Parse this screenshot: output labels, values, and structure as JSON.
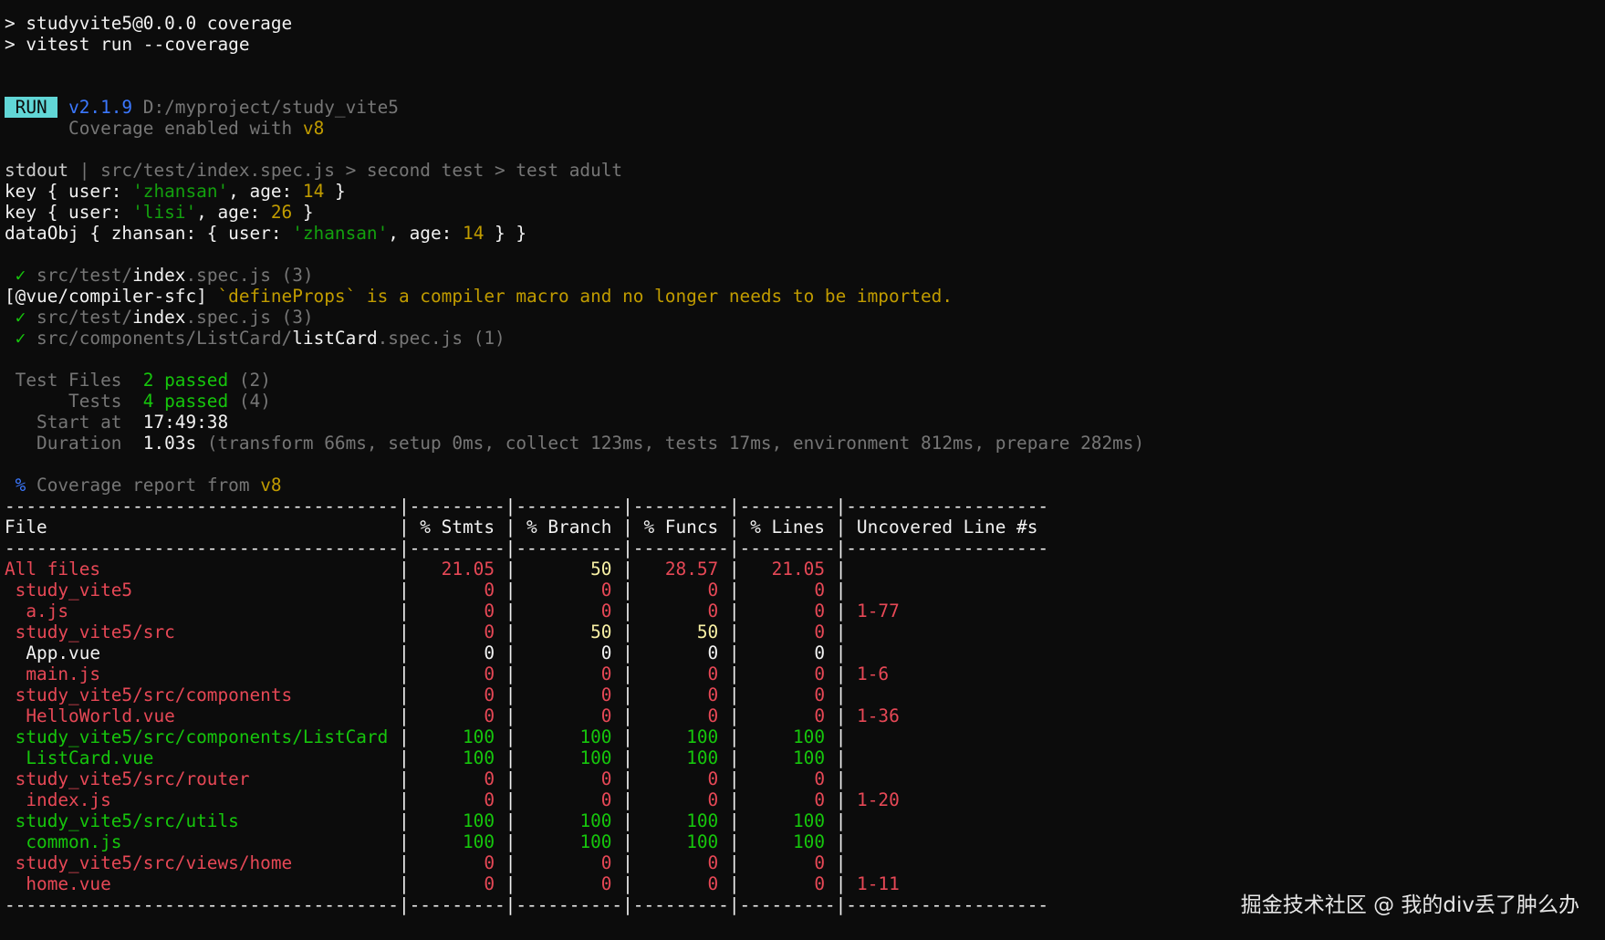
{
  "watermark": "掘金技术社区 @ 我的div丢了肿么办",
  "lines": [
    [
      {
        "t": "> studyvite5@0.0.0 coverage",
        "c": "white"
      }
    ],
    [
      {
        "t": "> vitest run --coverage",
        "c": "white"
      }
    ],
    [],
    [],
    [
      {
        "t": " RUN ",
        "c": "badge"
      },
      {
        "t": " ",
        "c": "default"
      },
      {
        "t": "v2.1.9",
        "c": "blue"
      },
      {
        "t": " D:/myproject/study_vite5",
        "c": "dim"
      }
    ],
    [
      {
        "t": "      Coverage enabled with ",
        "c": "dim"
      },
      {
        "t": "v8",
        "c": "orange"
      }
    ],
    [],
    [
      {
        "t": "stdout",
        "c": "default"
      },
      {
        "t": " | src/test/index.spec.js > second test > test adult",
        "c": "dim"
      }
    ],
    [
      {
        "t": "key { user: ",
        "c": "white"
      },
      {
        "t": "'zhansan'",
        "c": "str"
      },
      {
        "t": ", age: ",
        "c": "white"
      },
      {
        "t": "14",
        "c": "num"
      },
      {
        "t": " }",
        "c": "white"
      }
    ],
    [
      {
        "t": "key { user: ",
        "c": "white"
      },
      {
        "t": "'lisi'",
        "c": "str"
      },
      {
        "t": ", age: ",
        "c": "white"
      },
      {
        "t": "26",
        "c": "num"
      },
      {
        "t": " }",
        "c": "white"
      }
    ],
    [
      {
        "t": "dataObj { zhansan: { user: ",
        "c": "white"
      },
      {
        "t": "'zhansan'",
        "c": "str"
      },
      {
        "t": ", age: ",
        "c": "white"
      },
      {
        "t": "14",
        "c": "num"
      },
      {
        "t": " } }",
        "c": "white"
      }
    ],
    [],
    [
      {
        "t": " ✓",
        "c": "green"
      },
      {
        "t": " src/test/",
        "c": "dim"
      },
      {
        "t": "index",
        "c": "white"
      },
      {
        "t": ".spec.js (3)",
        "c": "dim"
      }
    ],
    [
      {
        "t": "[@vue/compiler-sfc] ",
        "c": "white"
      },
      {
        "t": "`defineProps` is a compiler macro and no longer needs to be imported.",
        "c": "orange"
      }
    ],
    [
      {
        "t": " ✓",
        "c": "green"
      },
      {
        "t": " src/test/",
        "c": "dim"
      },
      {
        "t": "index",
        "c": "white"
      },
      {
        "t": ".spec.js (3)",
        "c": "dim"
      }
    ],
    [
      {
        "t": " ✓",
        "c": "green"
      },
      {
        "t": " src/components/ListCard/",
        "c": "dim"
      },
      {
        "t": "listCard",
        "c": "white"
      },
      {
        "t": ".spec.js (1)",
        "c": "dim"
      }
    ],
    [],
    [
      {
        "t": " Test Files  ",
        "c": "dim"
      },
      {
        "t": "2 passed",
        "c": "green"
      },
      {
        "t": " (2)",
        "c": "dim"
      }
    ],
    [
      {
        "t": "      Tests  ",
        "c": "dim"
      },
      {
        "t": "4 passed",
        "c": "green"
      },
      {
        "t": " (4)",
        "c": "dim"
      }
    ],
    [
      {
        "t": "   Start at  ",
        "c": "dim"
      },
      {
        "t": "17:49:38",
        "c": "white"
      }
    ],
    [
      {
        "t": "   Duration  ",
        "c": "dim"
      },
      {
        "t": "1.03s",
        "c": "white"
      },
      {
        "t": " (transform 66ms, setup 0ms, collect 123ms, tests 17ms, environment 812ms, prepare 282ms)",
        "c": "dim"
      }
    ],
    [],
    [
      {
        "t": " %",
        "c": "blue"
      },
      {
        "t": " Coverage report from ",
        "c": "dim"
      },
      {
        "t": "v8",
        "c": "orange"
      }
    ],
    [
      {
        "t": "-------------------------------------|---------|----------|---------|---------|-------------------",
        "c": "white"
      }
    ],
    [
      {
        "t": "File                                 | % Stmts | % Branch | % Funcs | % Lines | Uncovered Line #s ",
        "c": "white"
      }
    ],
    [
      {
        "t": "-------------------------------------|---------|----------|---------|---------|-------------------",
        "c": "white"
      }
    ],
    [
      {
        "t": "All files                           ",
        "c": "red"
      },
      {
        "t": " | ",
        "c": "white"
      },
      {
        "t": "  21.05",
        "c": "red"
      },
      {
        "t": " | ",
        "c": "white"
      },
      {
        "t": "      50",
        "c": "yellow"
      },
      {
        "t": " | ",
        "c": "white"
      },
      {
        "t": "  28.57",
        "c": "red"
      },
      {
        "t": " | ",
        "c": "white"
      },
      {
        "t": "  21.05",
        "c": "red"
      },
      {
        "t": " | ",
        "c": "white"
      }
    ],
    [
      {
        "t": " study_vite5                        ",
        "c": "red"
      },
      {
        "t": " | ",
        "c": "white"
      },
      {
        "t": "      0",
        "c": "red"
      },
      {
        "t": " | ",
        "c": "white"
      },
      {
        "t": "       0",
        "c": "red"
      },
      {
        "t": " | ",
        "c": "white"
      },
      {
        "t": "      0",
        "c": "red"
      },
      {
        "t": " | ",
        "c": "white"
      },
      {
        "t": "      0",
        "c": "red"
      },
      {
        "t": " | ",
        "c": "white"
      }
    ],
    [
      {
        "t": "  a.js                              ",
        "c": "red"
      },
      {
        "t": " | ",
        "c": "white"
      },
      {
        "t": "      0",
        "c": "red"
      },
      {
        "t": " | ",
        "c": "white"
      },
      {
        "t": "       0",
        "c": "red"
      },
      {
        "t": " | ",
        "c": "white"
      },
      {
        "t": "      0",
        "c": "red"
      },
      {
        "t": " | ",
        "c": "white"
      },
      {
        "t": "      0",
        "c": "red"
      },
      {
        "t": " | ",
        "c": "white"
      },
      {
        "t": "1-77",
        "c": "red"
      }
    ],
    [
      {
        "t": " study_vite5/src                    ",
        "c": "red"
      },
      {
        "t": " | ",
        "c": "white"
      },
      {
        "t": "      0",
        "c": "red"
      },
      {
        "t": " | ",
        "c": "white"
      },
      {
        "t": "      50",
        "c": "yellow"
      },
      {
        "t": " | ",
        "c": "white"
      },
      {
        "t": "     50",
        "c": "yellow"
      },
      {
        "t": " | ",
        "c": "white"
      },
      {
        "t": "      0",
        "c": "red"
      },
      {
        "t": " | ",
        "c": "white"
      }
    ],
    [
      {
        "t": "  App.vue                           ",
        "c": "white"
      },
      {
        "t": " | ",
        "c": "white"
      },
      {
        "t": "      0",
        "c": "white"
      },
      {
        "t": " | ",
        "c": "white"
      },
      {
        "t": "       0",
        "c": "white"
      },
      {
        "t": " | ",
        "c": "white"
      },
      {
        "t": "      0",
        "c": "white"
      },
      {
        "t": " | ",
        "c": "white"
      },
      {
        "t": "      0",
        "c": "white"
      },
      {
        "t": " | ",
        "c": "white"
      }
    ],
    [
      {
        "t": "  main.js                           ",
        "c": "red"
      },
      {
        "t": " | ",
        "c": "white"
      },
      {
        "t": "      0",
        "c": "red"
      },
      {
        "t": " | ",
        "c": "white"
      },
      {
        "t": "       0",
        "c": "red"
      },
      {
        "t": " | ",
        "c": "white"
      },
      {
        "t": "      0",
        "c": "red"
      },
      {
        "t": " | ",
        "c": "white"
      },
      {
        "t": "      0",
        "c": "red"
      },
      {
        "t": " | ",
        "c": "white"
      },
      {
        "t": "1-6",
        "c": "red"
      }
    ],
    [
      {
        "t": " study_vite5/src/components         ",
        "c": "red"
      },
      {
        "t": " | ",
        "c": "white"
      },
      {
        "t": "      0",
        "c": "red"
      },
      {
        "t": " | ",
        "c": "white"
      },
      {
        "t": "       0",
        "c": "red"
      },
      {
        "t": " | ",
        "c": "white"
      },
      {
        "t": "      0",
        "c": "red"
      },
      {
        "t": " | ",
        "c": "white"
      },
      {
        "t": "      0",
        "c": "red"
      },
      {
        "t": " | ",
        "c": "white"
      }
    ],
    [
      {
        "t": "  HelloWorld.vue                    ",
        "c": "red"
      },
      {
        "t": " | ",
        "c": "white"
      },
      {
        "t": "      0",
        "c": "red"
      },
      {
        "t": " | ",
        "c": "white"
      },
      {
        "t": "       0",
        "c": "red"
      },
      {
        "t": " | ",
        "c": "white"
      },
      {
        "t": "      0",
        "c": "red"
      },
      {
        "t": " | ",
        "c": "white"
      },
      {
        "t": "      0",
        "c": "red"
      },
      {
        "t": " | ",
        "c": "white"
      },
      {
        "t": "1-36",
        "c": "red"
      }
    ],
    [
      {
        "t": " study_vite5/src/components/ListCard",
        "c": "green"
      },
      {
        "t": " | ",
        "c": "white"
      },
      {
        "t": "    100",
        "c": "green"
      },
      {
        "t": " | ",
        "c": "white"
      },
      {
        "t": "     100",
        "c": "green"
      },
      {
        "t": " | ",
        "c": "white"
      },
      {
        "t": "    100",
        "c": "green"
      },
      {
        "t": " | ",
        "c": "white"
      },
      {
        "t": "    100",
        "c": "green"
      },
      {
        "t": " | ",
        "c": "white"
      }
    ],
    [
      {
        "t": "  ListCard.vue                      ",
        "c": "green"
      },
      {
        "t": " | ",
        "c": "white"
      },
      {
        "t": "    100",
        "c": "green"
      },
      {
        "t": " | ",
        "c": "white"
      },
      {
        "t": "     100",
        "c": "green"
      },
      {
        "t": " | ",
        "c": "white"
      },
      {
        "t": "    100",
        "c": "green"
      },
      {
        "t": " | ",
        "c": "white"
      },
      {
        "t": "    100",
        "c": "green"
      },
      {
        "t": " | ",
        "c": "white"
      }
    ],
    [
      {
        "t": " study_vite5/src/router             ",
        "c": "red"
      },
      {
        "t": " | ",
        "c": "white"
      },
      {
        "t": "      0",
        "c": "red"
      },
      {
        "t": " | ",
        "c": "white"
      },
      {
        "t": "       0",
        "c": "red"
      },
      {
        "t": " | ",
        "c": "white"
      },
      {
        "t": "      0",
        "c": "red"
      },
      {
        "t": " | ",
        "c": "white"
      },
      {
        "t": "      0",
        "c": "red"
      },
      {
        "t": " | ",
        "c": "white"
      }
    ],
    [
      {
        "t": "  index.js                          ",
        "c": "red"
      },
      {
        "t": " | ",
        "c": "white"
      },
      {
        "t": "      0",
        "c": "red"
      },
      {
        "t": " | ",
        "c": "white"
      },
      {
        "t": "       0",
        "c": "red"
      },
      {
        "t": " | ",
        "c": "white"
      },
      {
        "t": "      0",
        "c": "red"
      },
      {
        "t": " | ",
        "c": "white"
      },
      {
        "t": "      0",
        "c": "red"
      },
      {
        "t": " | ",
        "c": "white"
      },
      {
        "t": "1-20",
        "c": "red"
      }
    ],
    [
      {
        "t": " study_vite5/src/utils              ",
        "c": "green"
      },
      {
        "t": " | ",
        "c": "white"
      },
      {
        "t": "    100",
        "c": "green"
      },
      {
        "t": " | ",
        "c": "white"
      },
      {
        "t": "     100",
        "c": "green"
      },
      {
        "t": " | ",
        "c": "white"
      },
      {
        "t": "    100",
        "c": "green"
      },
      {
        "t": " | ",
        "c": "white"
      },
      {
        "t": "    100",
        "c": "green"
      },
      {
        "t": " | ",
        "c": "white"
      }
    ],
    [
      {
        "t": "  common.js                         ",
        "c": "green"
      },
      {
        "t": " | ",
        "c": "white"
      },
      {
        "t": "    100",
        "c": "green"
      },
      {
        "t": " | ",
        "c": "white"
      },
      {
        "t": "     100",
        "c": "green"
      },
      {
        "t": " | ",
        "c": "white"
      },
      {
        "t": "    100",
        "c": "green"
      },
      {
        "t": " | ",
        "c": "white"
      },
      {
        "t": "    100",
        "c": "green"
      },
      {
        "t": " | ",
        "c": "white"
      }
    ],
    [
      {
        "t": " study_vite5/src/views/home         ",
        "c": "red"
      },
      {
        "t": " | ",
        "c": "white"
      },
      {
        "t": "      0",
        "c": "red"
      },
      {
        "t": " | ",
        "c": "white"
      },
      {
        "t": "       0",
        "c": "red"
      },
      {
        "t": " | ",
        "c": "white"
      },
      {
        "t": "      0",
        "c": "red"
      },
      {
        "t": " | ",
        "c": "white"
      },
      {
        "t": "      0",
        "c": "red"
      },
      {
        "t": " | ",
        "c": "white"
      }
    ],
    [
      {
        "t": "  home.vue                          ",
        "c": "red"
      },
      {
        "t": " | ",
        "c": "white"
      },
      {
        "t": "      0",
        "c": "red"
      },
      {
        "t": " | ",
        "c": "white"
      },
      {
        "t": "       0",
        "c": "red"
      },
      {
        "t": " | ",
        "c": "white"
      },
      {
        "t": "      0",
        "c": "red"
      },
      {
        "t": " | ",
        "c": "white"
      },
      {
        "t": "      0",
        "c": "red"
      },
      {
        "t": " | ",
        "c": "white"
      },
      {
        "t": "1-11",
        "c": "red"
      }
    ],
    [
      {
        "t": "-------------------------------------|---------|----------|---------|---------|-------------------",
        "c": "white"
      }
    ]
  ]
}
